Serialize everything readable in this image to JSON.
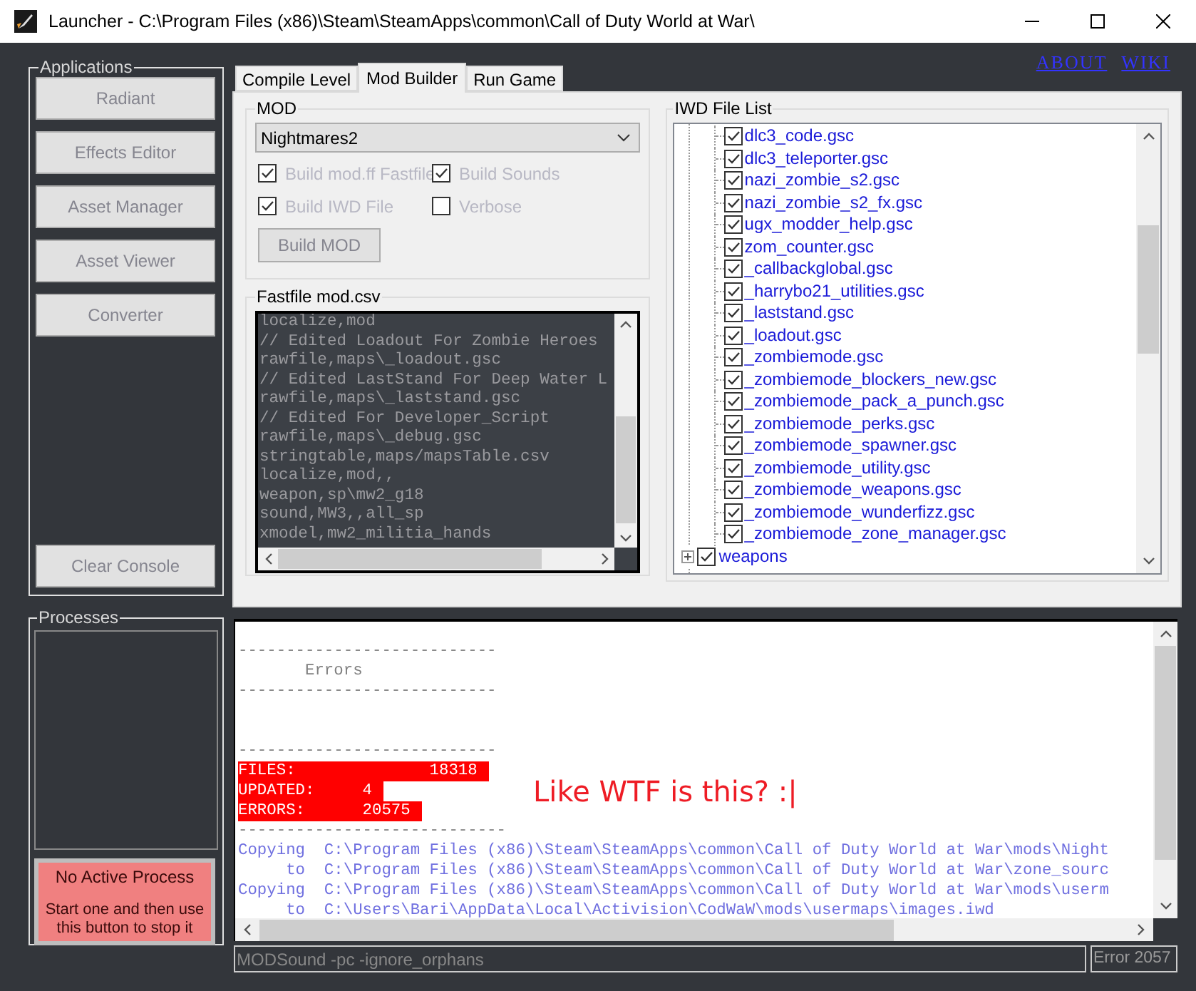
{
  "window": {
    "title": "Launcher - C:\\Program Files (x86)\\Steam\\SteamApps\\common\\Call of Duty World at War\\"
  },
  "links": [
    "ABOUT",
    "WIKI"
  ],
  "applications": {
    "title": "Applications",
    "buttons": [
      {
        "label": "Radiant",
        "disabled": true
      },
      {
        "label": "Effects Editor",
        "disabled": true
      },
      {
        "label": "Asset Manager",
        "disabled": true
      },
      {
        "label": "Asset Viewer",
        "disabled": true
      },
      {
        "label": "Converter",
        "disabled": true
      }
    ],
    "clear_button": {
      "label": "Clear Console",
      "disabled": true
    }
  },
  "tabs": [
    {
      "label": "Compile Level",
      "selected": false
    },
    {
      "label": "Mod Builder",
      "selected": true
    },
    {
      "label": "Run Game",
      "selected": false
    }
  ],
  "mod": {
    "title": "MOD",
    "dropdown": "Nightmares2",
    "options": [
      {
        "label": "Build mod.ff Fastfile",
        "checked": true,
        "disabled": true
      },
      {
        "label": "Build Sounds",
        "checked": true,
        "disabled": true
      },
      {
        "label": "Build IWD File",
        "checked": true,
        "disabled": true
      },
      {
        "label": "Verbose",
        "checked": false,
        "disabled": true
      }
    ],
    "build_button": {
      "label": "Build MOD",
      "disabled": true
    }
  },
  "fastfile": {
    "title": "Fastfile mod.csv",
    "lines": [
      "localize,mod",
      "// Edited Loadout For Zombie Heroes",
      "rawfile,maps\\_loadout.gsc",
      "// Edited LastStand For Deep Water L",
      "rawfile,maps\\_laststand.gsc",
      "// Edited For Developer_Script",
      "rawfile,maps\\_debug.gsc",
      "stringtable,maps/mapsTable.csv",
      "localize,mod,,",
      "weapon,sp\\mw2_g18",
      "sound,MW3,,all_sp",
      "xmodel,mw2_militia_hands"
    ]
  },
  "iwd_file_list": {
    "title": "IWD File List",
    "tree": [
      {
        "expanded": true,
        "children": [
          {
            "label": "dlc3_code.gsc",
            "checked": true
          },
          {
            "label": "dlc3_teleporter.gsc",
            "checked": true
          },
          {
            "label": "nazi_zombie_s2.gsc",
            "checked": true
          },
          {
            "label": "nazi_zombie_s2_fx.gsc",
            "checked": true
          },
          {
            "label": "ugx_modder_help.gsc",
            "checked": true
          },
          {
            "label": "zom_counter.gsc",
            "checked": true
          },
          {
            "label": "_callbackglobal.gsc",
            "checked": true
          },
          {
            "label": "_harrybo21_utilities.gsc",
            "checked": true
          },
          {
            "label": "_laststand.gsc",
            "checked": true
          },
          {
            "label": "_loadout.gsc",
            "checked": true
          },
          {
            "label": "_zombiemode.gsc",
            "checked": true
          },
          {
            "label": "_zombiemode_blockers_new.gsc",
            "checked": true
          },
          {
            "label": "_zombiemode_pack_a_punch.gsc",
            "checked": true
          },
          {
            "label": "_zombiemode_perks.gsc",
            "checked": true
          },
          {
            "label": "_zombiemode_spawner.gsc",
            "checked": true
          },
          {
            "label": "_zombiemode_utility.gsc",
            "checked": true
          },
          {
            "label": "_zombiemode_weapons.gsc",
            "checked": true
          },
          {
            "label": "_zombiemode_wunderfizz.gsc",
            "checked": true
          },
          {
            "label": "_zombiemode_zone_manager.gsc",
            "checked": true
          }
        ]
      },
      {
        "label": "weapons",
        "checked": true,
        "expanded": false
      }
    ]
  },
  "processes": {
    "title": "Processes",
    "stop_button": {
      "title": "No Active Process",
      "text": "Start one and then use this button to stop it"
    }
  },
  "console": {
    "lines": [
      {
        "kind": "blank"
      },
      {
        "kind": "rule",
        "text": "---------------------------"
      },
      {
        "kind": "plain",
        "text": "       Errors"
      },
      {
        "kind": "rule",
        "text": "---------------------------"
      },
      {
        "kind": "blank"
      },
      {
        "kind": "blank"
      },
      {
        "kind": "rule",
        "text": "---------------------------"
      },
      {
        "kind": "alert",
        "text": "FILES:              18318"
      },
      {
        "kind": "alert",
        "text": "UPDATED:     4"
      },
      {
        "kind": "alert",
        "text": "ERRORS:      20575"
      },
      {
        "kind": "rule",
        "text": "----------------------------"
      },
      {
        "kind": "path",
        "text": "Copying  C:\\Program Files (x86)\\Steam\\SteamApps\\common\\Call of Duty World at War\\mods\\Night"
      },
      {
        "kind": "path",
        "text": "     to  C:\\Program Files (x86)\\Steam\\SteamApps\\common\\Call of Duty World at War\\zone_sourc"
      },
      {
        "kind": "path",
        "text": "Copying  C:\\Program Files (x86)\\Steam\\SteamApps\\common\\Call of Duty World at War\\mods\\userm"
      },
      {
        "kind": "path",
        "text": "     to  C:\\Users\\Bari\\AppData\\Local\\Activision\\CodWaW\\mods\\usermaps\\images.iwd"
      }
    ],
    "note": "Like WTF is this? :|"
  },
  "command": "MODSound -pc -ignore_orphans",
  "status": "Error 2057"
}
